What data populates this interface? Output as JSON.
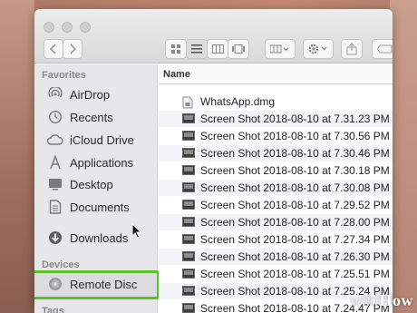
{
  "sidebar": {
    "favorites_header": "Favorites",
    "favorites": [
      {
        "label": "AirDrop",
        "icon": "airdrop-icon"
      },
      {
        "label": "Recents",
        "icon": "clock-icon"
      },
      {
        "label": "iCloud Drive",
        "icon": "cloud-icon"
      },
      {
        "label": "Applications",
        "icon": "applications-icon"
      },
      {
        "label": "Desktop",
        "icon": "desktop-icon"
      },
      {
        "label": "Documents",
        "icon": "document-icon"
      },
      {
        "label": "Downloads",
        "icon": "download-icon",
        "selected": true
      }
    ],
    "devices_header": "Devices",
    "devices": [
      {
        "label": "Remote Disc",
        "icon": "disc-icon"
      }
    ],
    "tags_header": "Tags"
  },
  "list": {
    "column_name": "Name",
    "files": [
      "WhatsApp.dmg",
      "Screen Shot 2018-08-10 at 7.31.23 PM",
      "Screen Shot 2018-08-10 at 7.30.56 PM",
      "Screen Shot 2018-08-10 at 7.30.46 PM",
      "Screen Shot 2018-08-10 at 7.30.18 PM",
      "Screen Shot 2018-08-10 at 7.30.08 PM",
      "Screen Shot 2018-08-10 at 7.29.52 PM",
      "Screen Shot 2018-08-10 at 7.28.00 PM",
      "Screen Shot 2018-08-10 at 7.27.34 PM",
      "Screen Shot 2018-08-10 at 7.26.30 PM",
      "Screen Shot 2018-08-10 at 7.25.51 PM",
      "Screen Shot 2018-08-10 at 7.25.24 PM",
      "Screen Shot 2018-08-10 at 7.24.47 PM"
    ]
  },
  "colors": {
    "highlight": "#5ac12a",
    "sidebar_bg": "#e7e7e9",
    "row_alt": "#f2f4f7"
  },
  "watermark": {
    "part1": "wiki",
    "part2": "How"
  }
}
